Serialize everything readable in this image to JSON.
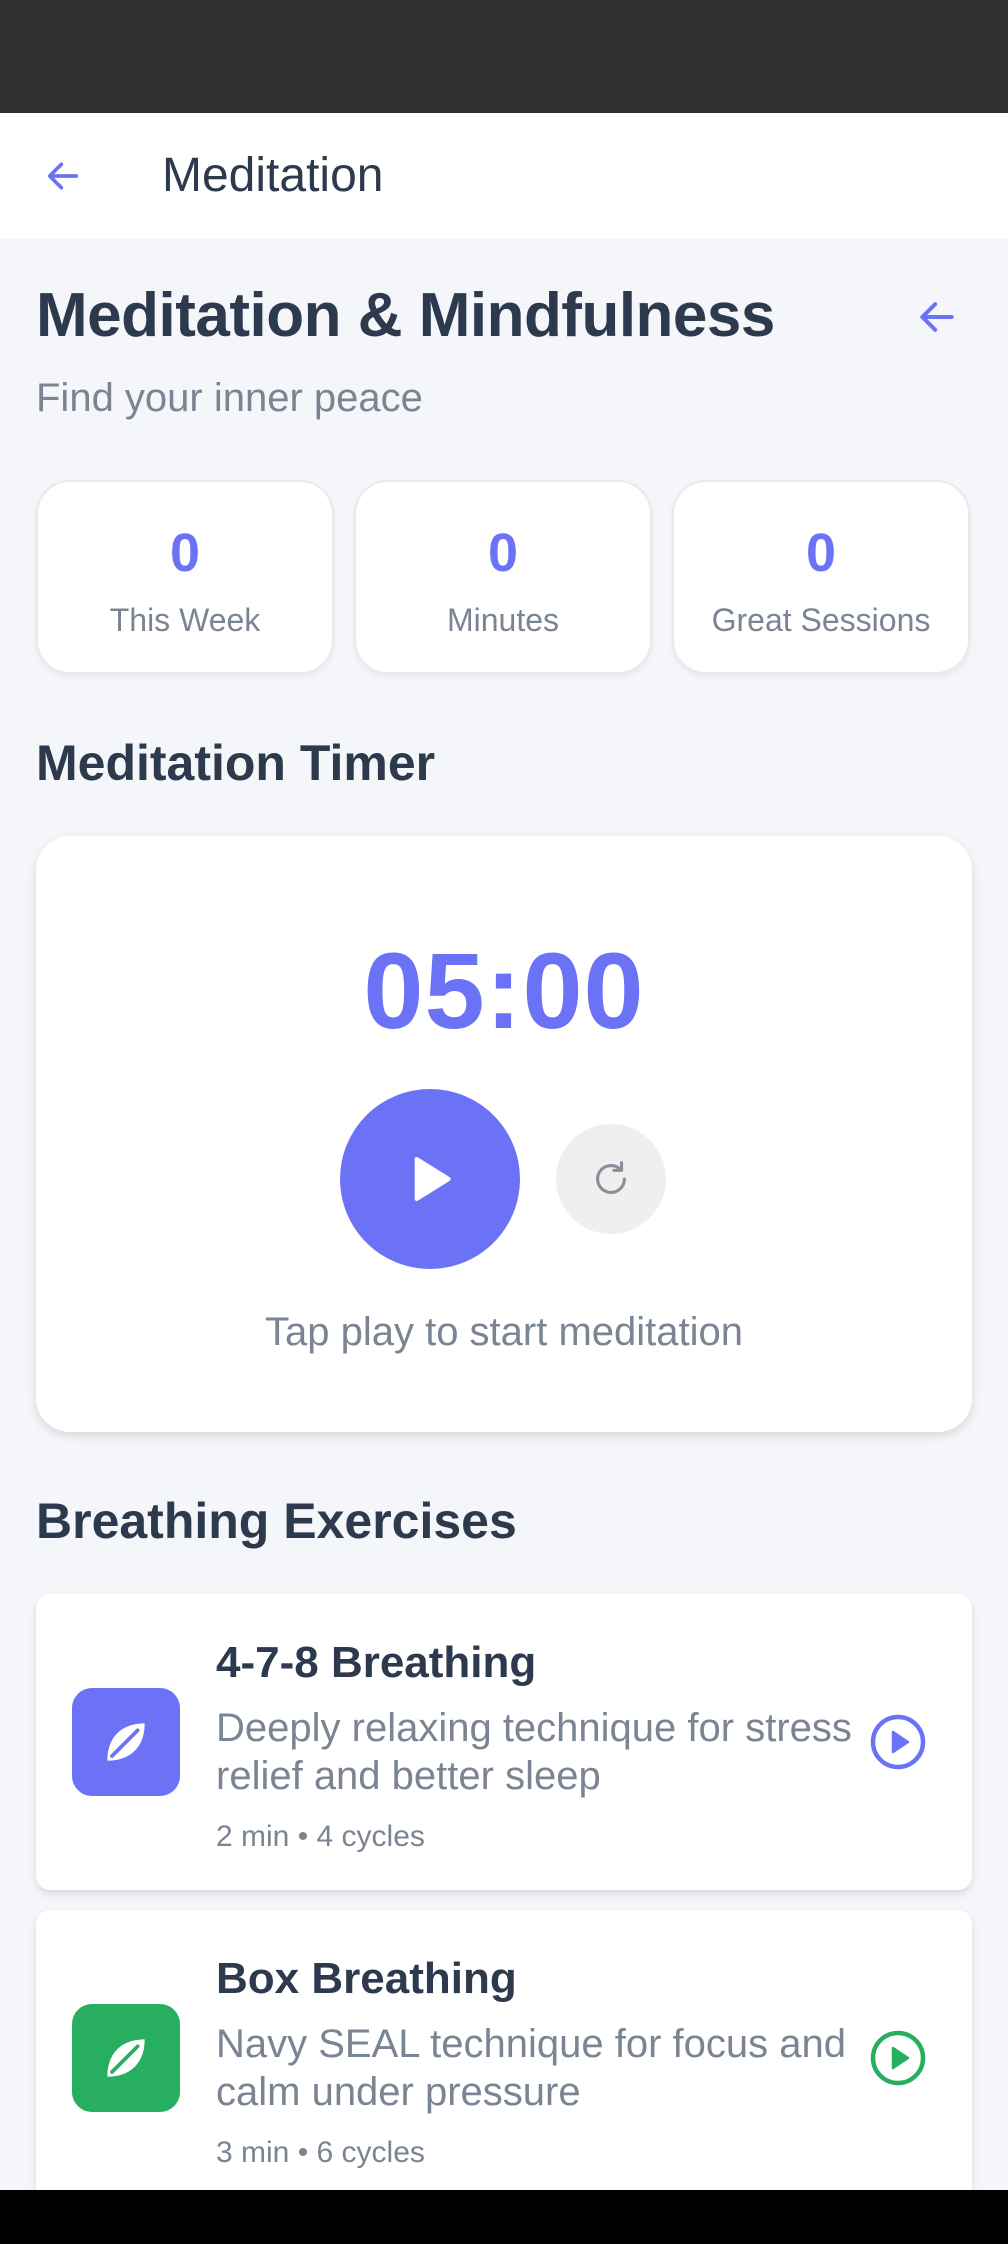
{
  "app_bar": {
    "title": "Meditation"
  },
  "header": {
    "title": "Meditation & Mindfulness",
    "subtitle": "Find your inner peace"
  },
  "stats": [
    {
      "value": "0",
      "label": "This Week"
    },
    {
      "value": "0",
      "label": "Minutes"
    },
    {
      "value": "0",
      "label": "Great Sessions"
    }
  ],
  "timer": {
    "section_title": "Meditation Timer",
    "display": "05:00",
    "hint": "Tap play to start meditation"
  },
  "breathing": {
    "section_title": "Breathing Exercises",
    "items": [
      {
        "name": "4-7-8 Breathing",
        "description": "Deeply relaxing technique for stress relief and better sleep",
        "meta": "2 min • 4 cycles",
        "icon": "leaf-icon",
        "color": "#6c72f5"
      },
      {
        "name": "Box Breathing",
        "description": "Navy SEAL technique for focus and calm under pressure",
        "meta": "3 min • 6 cycles",
        "icon": "leaf-icon",
        "color": "#27ae60"
      }
    ]
  },
  "colors": {
    "accent": "#6c72f5",
    "green": "#27ae60",
    "text": "#2d3a4e",
    "muted": "#7b8493",
    "background": "#f5f6f9"
  }
}
